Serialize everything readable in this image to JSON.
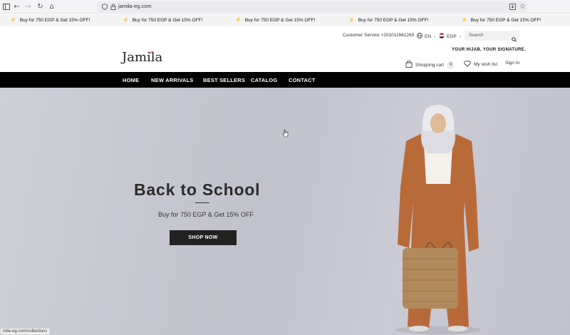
{
  "browser": {
    "url": "jamila-eg.com",
    "status_url": "mila-eg.com/collections",
    "icons": [
      "sidebar-icon",
      "back-icon",
      "forward-icon",
      "reload-icon",
      "home-icon",
      "shield-icon",
      "lock-icon",
      "download-icon",
      "star-icon"
    ]
  },
  "promo": {
    "items": [
      "Buy for 750 EGP & Get 15% OFF!",
      "Buy for 750 EGP & Get 15% OFF!",
      "Buy for 750 EGP & Get 15% OFF!",
      "Buy for 750 EGP & Get 15% OFF!",
      "Buy for 750 EGP & Get 15% OFF!"
    ]
  },
  "header": {
    "customer_service": "Customer Service +201011661269",
    "language": "EN",
    "currency": "EGP",
    "search_placeholder": "Search",
    "tagline": "YOUR HIJAB, YOUR SIGNATURE.",
    "logo": "Jamila",
    "shopping_cart": "Shopping cart",
    "cart_count": "0",
    "wish_list": "My wish list",
    "sign_in": "Sign In"
  },
  "nav": {
    "items": [
      "HOME",
      "NEW ARRIVALS",
      "BEST SELLERS",
      "CATALOG",
      "CONTACT"
    ]
  },
  "hero": {
    "title": "Back to School",
    "subtitle": "Buy for 750 EGP & Get 15% OFF",
    "cta": "SHOP NOW"
  },
  "colors": {
    "nav_bg": "#000000",
    "button_bg": "#222222",
    "hero_bg": "#c6c6d0",
    "logo_accent": "#e0574c"
  }
}
